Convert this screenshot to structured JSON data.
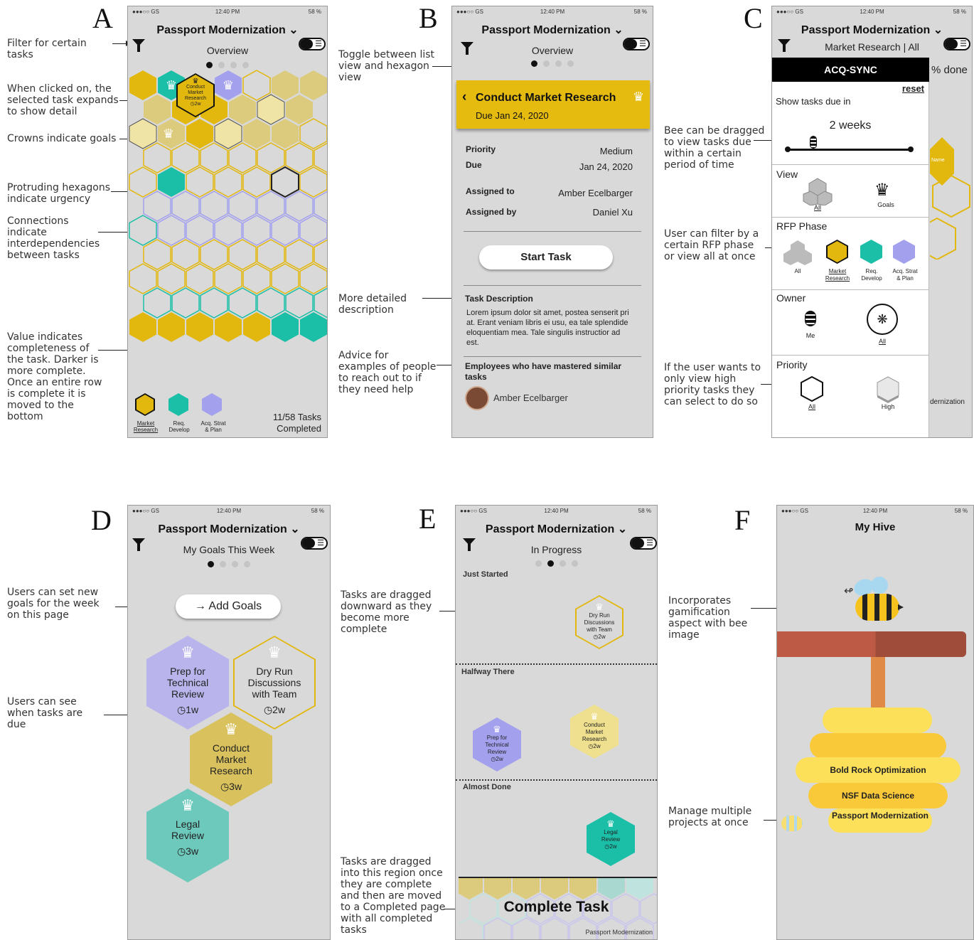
{
  "panels": {
    "a": "A",
    "b": "B",
    "c": "C",
    "d": "D",
    "e": "E",
    "f": "F"
  },
  "status": {
    "carrier": "●●●○○ GS",
    "time": "12:40 PM",
    "battery": "58 %"
  },
  "project_title": "Passport Modernization",
  "panel_a": {
    "subtitle": "Overview",
    "expanded_task": {
      "line1": "Conduct",
      "line2": "Market",
      "line3": "Research",
      "due": "2w"
    },
    "legend": [
      {
        "label1": "Market",
        "label2": "Research",
        "color": "#e2b80f"
      },
      {
        "label1": "Req.",
        "label2": "Develop",
        "color": "#1bbfa8"
      },
      {
        "label1": "Acq. Strat",
        "label2": "& Plan",
        "color": "#a3a0ee"
      }
    ],
    "completed_line1": "11/58 Tasks",
    "completed_line2": "Completed",
    "annotations": [
      "Filter for certain tasks",
      "When clicked on, the selected task expands to show detail",
      "Crowns indicate goals",
      "Protruding hexagons indicate urgency",
      "Connections indicate interdependencies between tasks",
      "Value indicates completeness of the task.  Darker is more complete. Once an entire row is complete it is moved to the bottom"
    ]
  },
  "panel_b": {
    "subtitle": "Overview",
    "task_title": "Conduct Market Research",
    "task_due": "Due Jan 24, 2020",
    "details": [
      {
        "k": "Priority",
        "v": "Medium"
      },
      {
        "k": "Due",
        "v": "Jan 24, 2020"
      },
      {
        "k": "Assigned to",
        "v": "Amber Ecelbarger"
      },
      {
        "k": "Assigned by",
        "v": "Daniel Xu"
      }
    ],
    "start_button": "Start Task",
    "desc_heading": "Task Description",
    "desc_text": "Lorem ipsum dolor sit amet, postea senserit pri at. Erant veniam libris ei usu, ea tale splendide eloquentiam mea. Tale singulis instructior ad est.",
    "experts_heading": "Employees who have mastered similar tasks",
    "expert_name": "Amber Ecelbarger",
    "annotations": [
      "Toggle between list view and hexagon view",
      "More detailed description",
      "Advice for examples of people to reach out to if they need help"
    ]
  },
  "panel_c": {
    "subtitle": "Market Research | All",
    "brand": "ACQ-SYNC",
    "behind_done": "% done",
    "behind_name": "Name",
    "behind_footer": "dernization",
    "reset": "reset",
    "show_due": "Show tasks due in",
    "weeks": "2 weeks",
    "view_heading": "View",
    "view_all": "All",
    "view_goals": "Goals",
    "rfp_heading": "RFP Phase",
    "rfp": [
      {
        "l1": "All",
        "l2": ""
      },
      {
        "l1": "Market",
        "l2": "Research"
      },
      {
        "l1": "Req.",
        "l2": "Develop"
      },
      {
        "l1": "Acq. Strat",
        "l2": "& Plan"
      }
    ],
    "owner_heading": "Owner",
    "owner_me": "Me",
    "owner_all": "All",
    "priority_heading": "Priority",
    "priority_all": "All",
    "priority_high": "High",
    "annotations": [
      "Bee can be dragged to view tasks due within a certain period of time",
      "User can filter by a certain RFP phase or view all at once",
      "If the user wants to only view high priority tasks they can select to do so"
    ]
  },
  "panel_d": {
    "subtitle": "My Goals This Week",
    "add_goals": "Add Goals",
    "goals": [
      {
        "l1": "Prep for",
        "l2": "Technical",
        "l3": "Review",
        "due": "1w",
        "color": "#b9b5ec",
        "border": "#b9b5ec",
        "text": "#222"
      },
      {
        "l1": "Dry Run",
        "l2": "Discussions",
        "l3": "with Team",
        "due": "2w",
        "color": "#d9d9d9",
        "border": "#e2b80f",
        "text": "#222"
      },
      {
        "l1": "Conduct",
        "l2": "Market",
        "l3": "Research",
        "due": "3w",
        "color": "#d9c25d",
        "border": "#d9c25d",
        "text": "#222"
      },
      {
        "l1": "Legal",
        "l2": "Review",
        "l3": "",
        "due": "3w",
        "color": "#6dc9bc",
        "border": "#6dc9bc",
        "text": "#222"
      }
    ],
    "annotations": [
      "Users can set new goals for the week on this page",
      "Users can see when tasks are due"
    ]
  },
  "panel_e": {
    "subtitle": "In Progress",
    "sections": [
      "Just Started",
      "Halfway There",
      "Almost Done"
    ],
    "tasks": [
      {
        "l1": "Dry Run",
        "l2": "Discussions",
        "l3": "with Team",
        "due": "2w"
      },
      {
        "l1": "Prep for",
        "l2": "Technical",
        "l3": "Review",
        "due": "2w"
      },
      {
        "l1": "Conduct",
        "l2": "Market",
        "l3": "Research",
        "due": "2w"
      },
      {
        "l1": "Legal",
        "l2": "Review",
        "l3": "",
        "due": "2w"
      }
    ],
    "complete": "Complete Task",
    "footer": "Passport Modernization",
    "annotations": [
      "Tasks are dragged downward as they become more complete",
      "Tasks are dragged into this region once they are complete and then are moved to a Completed page with all completed tasks"
    ]
  },
  "panel_f": {
    "title": "My Hive",
    "projects": [
      "Bold Rock Optimization",
      "NSF Data Science",
      "Passport Modernization"
    ],
    "annotations": [
      "Incorporates gamification aspect with bee image",
      "Manage multiple projects at once"
    ]
  }
}
